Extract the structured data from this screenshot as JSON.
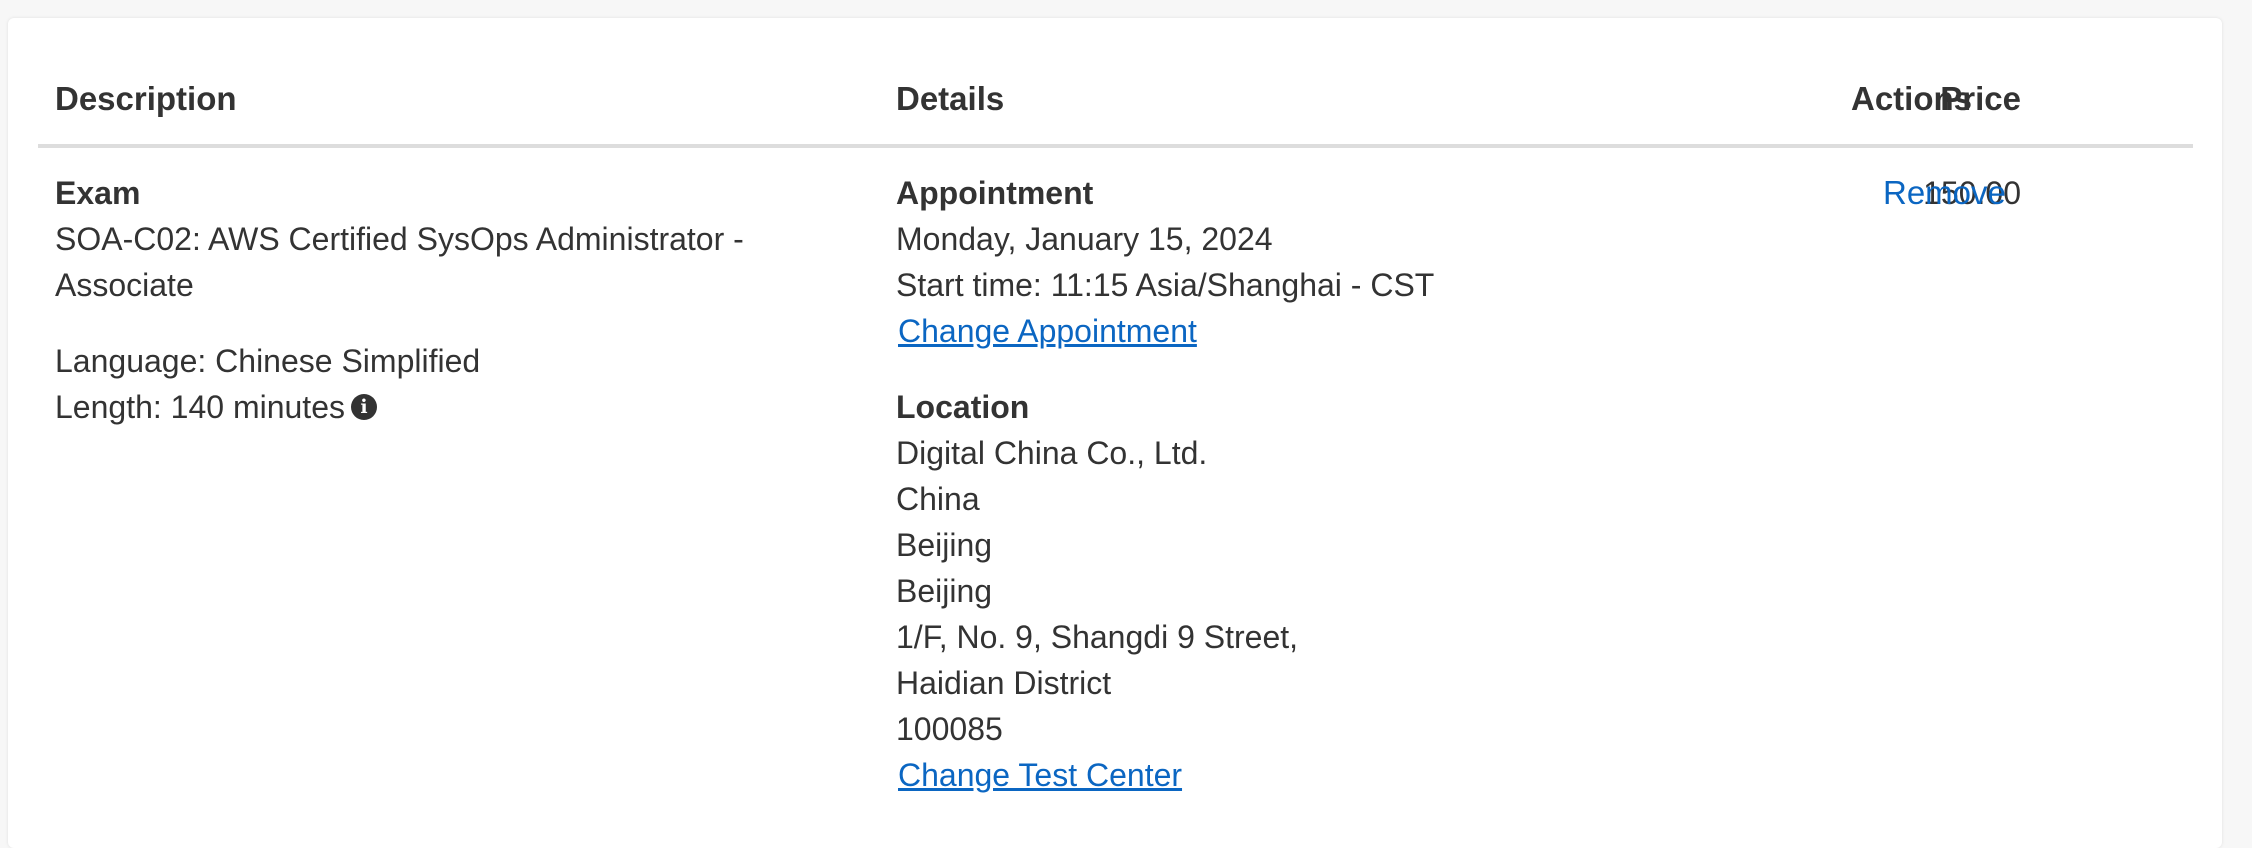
{
  "table": {
    "headers": {
      "description": "Description",
      "details": "Details",
      "price": "Price",
      "actions": "Actions"
    },
    "row": {
      "exam_label": "Exam",
      "exam_name": "SOA-C02: AWS Certified SysOps Administrator - Associate",
      "language": "Language: Chinese Simplified",
      "length": "Length: 140 minutes",
      "info_icon": "info-circle-icon",
      "appointment_label": "Appointment",
      "appointment_date": "Monday, January 15, 2024",
      "start_time": "Start time: 11:15 Asia/Shanghai - CST",
      "change_appointment": "Change Appointment",
      "location_label": "Location",
      "location_lines": [
        "Digital China Co., Ltd.",
        "China",
        "Beijing",
        "Beijing",
        "1/F, No. 9, Shangdi 9 Street,",
        "Haidian District",
        "100085"
      ],
      "change_test_center": "Change Test Center",
      "price": "150.00",
      "remove": "Remove"
    }
  },
  "colors": {
    "link": "#0b66c2",
    "text": "#333333",
    "divider": "#dddddd"
  }
}
